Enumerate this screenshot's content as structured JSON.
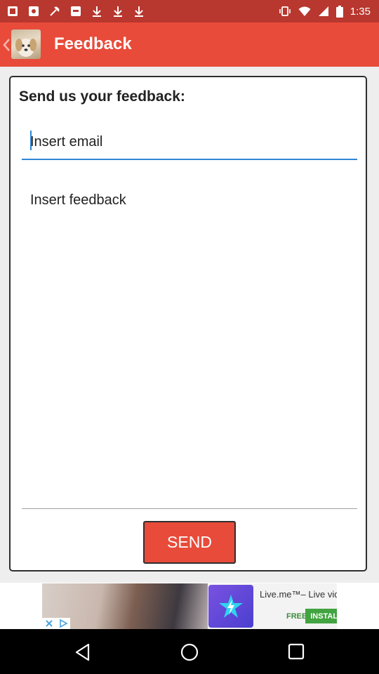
{
  "status_bar": {
    "time": "1:35",
    "notification_icons": [
      "app-icon",
      "app-icon",
      "tools-icon",
      "app-icon",
      "download-icon",
      "download-icon",
      "download-icon"
    ],
    "system_icons": [
      "vibrate-icon",
      "wifi-icon",
      "signal-icon",
      "battery-icon"
    ]
  },
  "app_bar": {
    "title": "Feedback",
    "back_icon": "chevron-left-icon"
  },
  "form": {
    "heading": "Send us your feedback:",
    "email_placeholder": "Insert email",
    "feedback_placeholder": "Insert feedback",
    "send_label": "SEND"
  },
  "ad": {
    "title": "Live.me™– Live video s...",
    "free_label": "FREE",
    "install_label": "INSTALL"
  },
  "colors": {
    "status_bar": "#b8372e",
    "app_bar": "#e84b3a",
    "send_button": "#e84b3a",
    "input_focus": "#2f86d6"
  },
  "nav_bar": {
    "icons": [
      "back-triangle-icon",
      "home-circle-icon",
      "recents-square-icon"
    ]
  }
}
